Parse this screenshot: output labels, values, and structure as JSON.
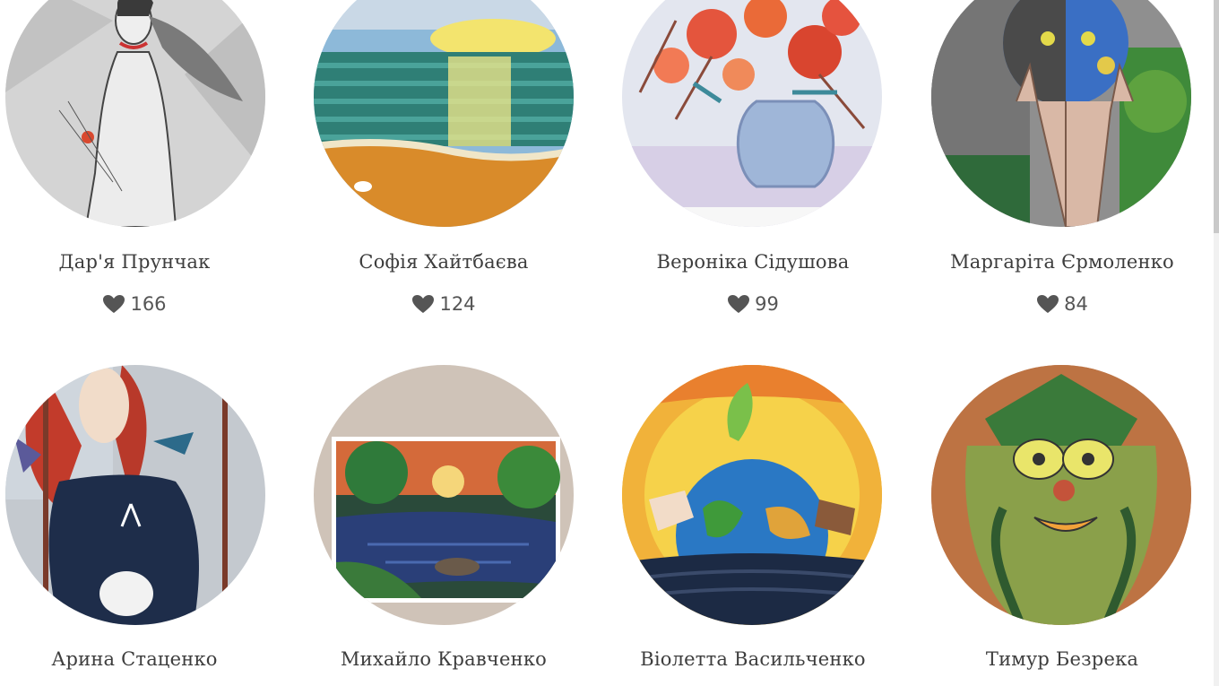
{
  "gallery": {
    "entries": [
      {
        "name": "Дар'я Прунчак",
        "likes": "166",
        "artwork_icon": "woman-sketch-artwork"
      },
      {
        "name": "Софія Хайтбаєва",
        "likes": "124",
        "artwork_icon": "sea-sunset-artwork"
      },
      {
        "name": "Вероніка Сідушова",
        "likes": "99",
        "artwork_icon": "flower-vase-artwork"
      },
      {
        "name": "Маргаріта Єрмоленко",
        "likes": "84",
        "artwork_icon": "hands-globe-artwork"
      },
      {
        "name": "Арина Стаценко",
        "artwork_icon": "woman-swing-artwork"
      },
      {
        "name": "Михайло Кравченко",
        "artwork_icon": "river-landscape-artwork"
      },
      {
        "name": "Віолетта Васильченко",
        "artwork_icon": "earth-hands-artwork"
      },
      {
        "name": "Тимур Безрека",
        "artwork_icon": "forest-spirit-artwork"
      }
    ],
    "like_icon": "heart-icon"
  }
}
